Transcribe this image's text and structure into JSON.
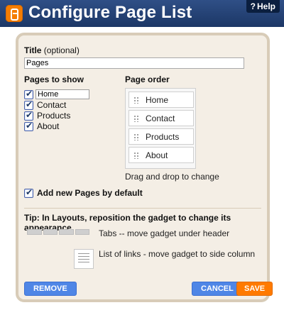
{
  "header": {
    "title": "Configure Page List",
    "help": "Help"
  },
  "title_field": {
    "label": "Title",
    "optional": "(optional)",
    "value": "Pages"
  },
  "pages_to_show": {
    "label": "Pages to show",
    "items": [
      {
        "label": "Home",
        "checked": true,
        "editable": true
      },
      {
        "label": "Contact",
        "checked": true
      },
      {
        "label": "Products",
        "checked": true
      },
      {
        "label": "About",
        "checked": true
      }
    ]
  },
  "page_order": {
    "label": "Page order",
    "items": [
      "Home",
      "Contact",
      "Products",
      "About"
    ],
    "note": "Drag and drop to change"
  },
  "add_new_pages": {
    "label": "Add new Pages by default",
    "checked": true
  },
  "tip": {
    "text": "Tip: In Layouts, reposition the gadget to change its appearance."
  },
  "layout_options": [
    {
      "label": "Tabs -- move gadget under header",
      "icon": "tabs-icon"
    },
    {
      "label": "List of links - move gadget to side column",
      "icon": "list-icon"
    }
  ],
  "buttons": {
    "remove": "REMOVE",
    "cancel": "CANCEL",
    "save": "SAVE"
  },
  "colors": {
    "header": "#1f3b6d",
    "panel": "#f4eee5",
    "primary_button": "#4f86e6",
    "save_button": "#ff7a00"
  }
}
